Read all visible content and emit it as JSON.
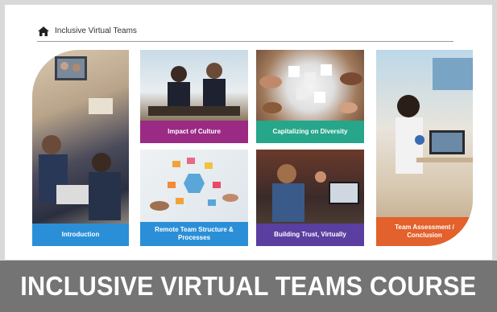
{
  "header": {
    "title": "Inclusive Virtual Teams",
    "icon": "home-icon"
  },
  "tiles": [
    {
      "label": "Introduction",
      "color": "#2b8fd8"
    },
    {
      "label": "Impact of Culture",
      "color": "#9b2a84"
    },
    {
      "label": "Capitalizing on Diversity",
      "color": "#26a68a"
    },
    {
      "label": "Remote Team Structure & Processes",
      "color": "#2b8fd8"
    },
    {
      "label": "Building Trust, Virtually",
      "color": "#5a3ea0"
    },
    {
      "label": "Team Assessment / Conclusion",
      "color": "#e2612c"
    }
  ],
  "banner": {
    "text": "INCLUSIVE VIRTUAL TEAMS COURSE"
  }
}
